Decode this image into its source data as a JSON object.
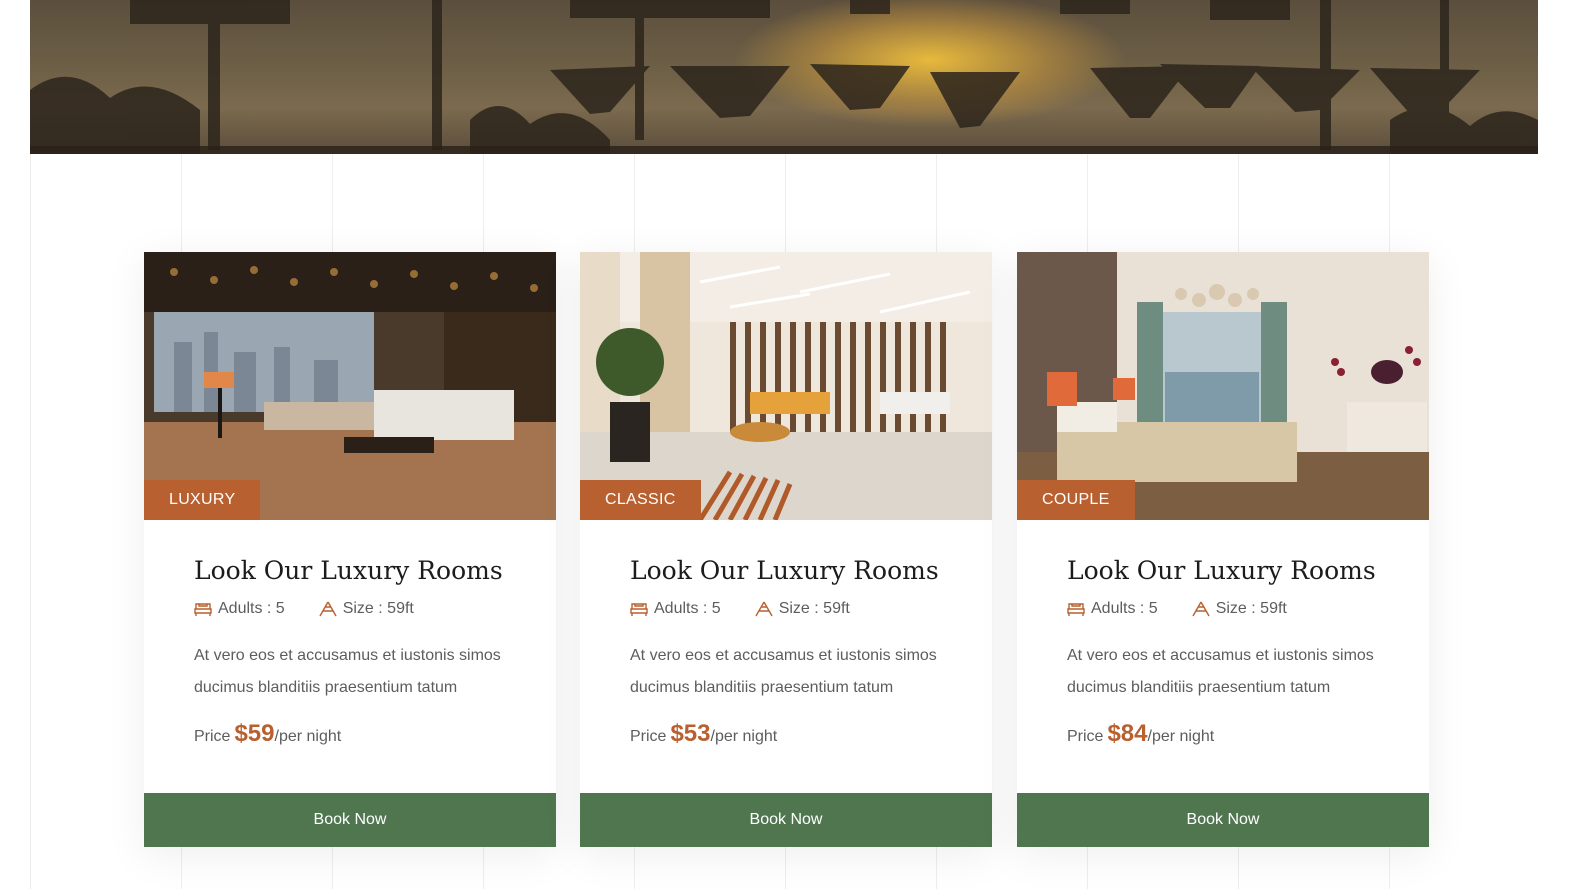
{
  "rooms": [
    {
      "category": "LUXURY",
      "title": "Look Our Luxury Rooms",
      "adults": "Adults : 5",
      "size": "Size : 59ft",
      "description": "At vero eos et accusamus et iustonis simos ducimus blanditiis praesentium tatum",
      "price_label": "Price",
      "price": "$59",
      "price_unit": "/per night",
      "cta": "Book Now"
    },
    {
      "category": "CLASSIC",
      "title": "Look Our Luxury Rooms",
      "adults": "Adults : 5",
      "size": "Size : 59ft",
      "description": "At vero eos et accusamus et iustonis simos ducimus blanditiis praesentium tatum",
      "price_label": "Price",
      "price": "$53",
      "price_unit": "/per night",
      "cta": "Book Now"
    },
    {
      "category": "COUPLE",
      "title": "Look Our Luxury Rooms",
      "adults": "Adults : 5",
      "size": "Size : 59ft",
      "description": "At vero eos et accusamus et iustonis simos ducimus blanditiis praesentium tatum",
      "price_label": "Price",
      "price": "$84",
      "price_unit": "/per night",
      "cta": "Book Now"
    }
  ],
  "icons": {
    "adults": "bed-icon",
    "size": "area-size-icon"
  },
  "colors": {
    "accent": "#b8602f",
    "button": "#507650",
    "text": "#5d5d5d",
    "title": "#1c1c1c"
  }
}
